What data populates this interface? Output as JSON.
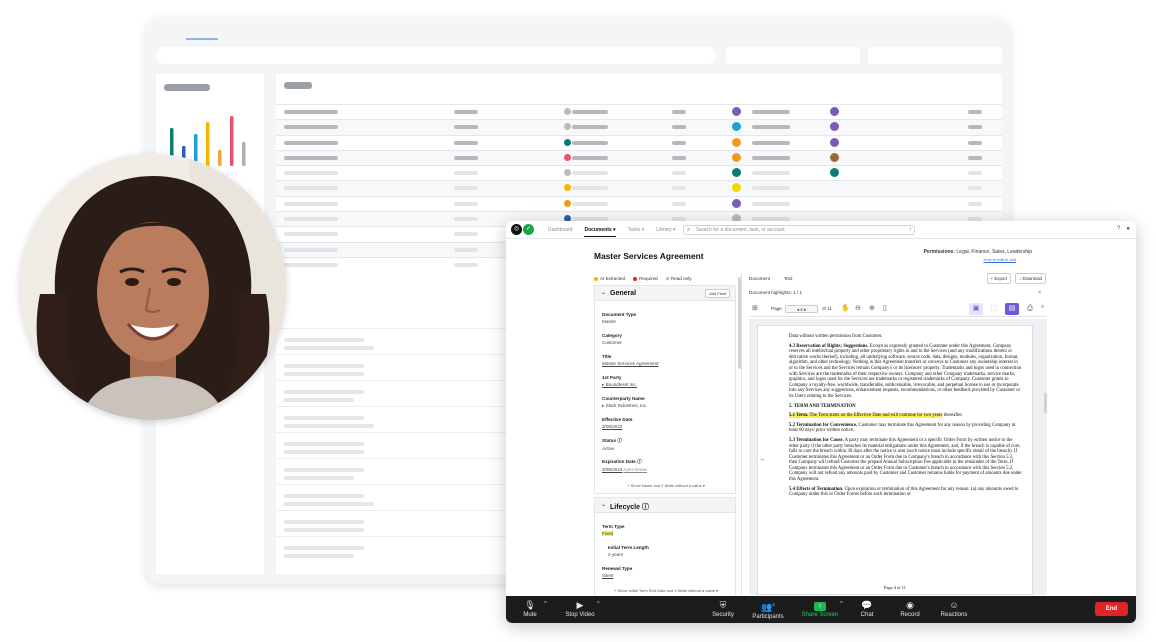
{
  "app": {
    "nav": [
      "Dashboard",
      "Documents ▾",
      "Tasks ▾",
      "Library ▾"
    ],
    "search_placeholder": "Search for a document, task, or account",
    "search_shortcut": "/"
  },
  "document": {
    "title": "Master Services Agreement",
    "permissions_label": "Permissions:",
    "permissions_value": "Legal, Finance, Sales, Leadership",
    "permissions_link": "How to edit/or add",
    "legend": [
      "AI Extracted",
      "Required",
      "Read only"
    ],
    "legend_colors": [
      "#f2b300",
      "#e0242a",
      "#888888"
    ]
  },
  "general": {
    "title": "General",
    "add_field": "Add Field",
    "fields": [
      {
        "label": "Document Type",
        "value": "Master"
      },
      {
        "label": "Category",
        "value": "Customer"
      },
      {
        "label": "Title",
        "value": "Master Services Agreement"
      },
      {
        "label": "1st Party",
        "value": "▸ Boundlesst Inc."
      },
      {
        "label": "Counterparty Name",
        "value": "▸ Stark Industries, Inc."
      },
      {
        "label": "Effective Date",
        "value": "3/08/2022"
      },
      {
        "label": "Status ⓘ",
        "value": "Active"
      },
      {
        "label": "Expiration Date ⓘ",
        "value": "3/09/2024"
      }
    ],
    "expiration_extra": "Auto-renew",
    "show_more": "+ Show Name and 2 fields without a value ▾"
  },
  "lifecycle": {
    "title": "Lifecycle ⓘ",
    "fields": [
      {
        "label": "Term Type",
        "value": "Fixed"
      },
      {
        "label": "Initial Term Length",
        "value": "2 years"
      },
      {
        "label": "Renewal Type",
        "value": "Silent"
      }
    ],
    "show_more": "+ Show Initial Term End Date and 4 fields without a value ▾"
  },
  "viewer": {
    "tabs": [
      "Document",
      "Text"
    ],
    "export": "+ Export",
    "download": "↓ Download",
    "highlights": "Document highlights: 1 / 1",
    "page_label": "Page",
    "page_value": "4",
    "page_of": "of 11",
    "page_number": "Page 4 of 11"
  },
  "contract": {
    "p0": "Data without written permission from Customer.",
    "p1_head": "4.3 Reservation of Rights; Suggestions.",
    "p1_body": " Except as expressly granted to Customer under this Agreement, Company reserves all intellectual property and other proprietary rights in and to the Services (and any modifications thereto or derivative works thereof), including, all underlying software, source code, data, designs, modules, organization, format, algorithm, and other technology. Nothing in this Agreement transfers or conveys to Customer any ownership interest in or to the Services and the Services remain Company's or its licensors' property. Trademarks and logos used in connection with Services are the trademarks of their respective owners. Company and other Company trademarks, service marks, graphics, and logos used for the Services are trademarks or registered trademarks of Company. Customer grants to Company a royalty-free, worldwide, transferable, sublicensable, irrevocable, and perpetual license to use or incorporate into any Services any suggestions, enhancement requests, recommendations, or other feedback provided by Customer or its Users relating to the Services.",
    "s5": "5. TERM AND TERMINATION",
    "p51_head": "5.1 Term.",
    "p51_hl": " The Term starts on the Effective Date and will continue for two years",
    "p51_tail": " thereafter.",
    "p52_head": "5.2 Termination for Convenience.",
    "p52_body": " Customer may terminate this Agreement for any reason by providing Company at least 60 days' prior written notice.",
    "p53_head": "5.3 Termination for Cause.",
    "p53_body": " A party may terminate this Agreement or a specific Order Form by written notice to the other party if the other party breaches its material obligations under this Agreement, and, if the breach is capable of cure, fails to cure the breach within 30 days after the notice is sent (such notice must include specific detail of the breach). If Customer terminates this Agreement or an Order Form due to Company's breach in accordance with this Section 5.3, then Company will refund Customer the prepaid Annual Subscription Fee applicable to the remainder of the Term. If Company terminates this Agreement or an Order Form due to Customer's breach in accordance with this Section 5.2, Company will not refund any amounts paid by Customer and Customer remains liable for payment of amounts due under this Agreement.",
    "p54_head": "5.4 Effects of Termination.",
    "p54_body": " Upon expiration or termination of this Agreement for any reason: (a) any amounts owed to Company under this or Order Forms before such termination or"
  },
  "meeting": {
    "mute": "Mute",
    "video": "Stop Video",
    "security": "Security",
    "participants": "Participants",
    "participants_count": "2",
    "share": "Share Screen",
    "chat": "Chat",
    "record": "Record",
    "reactions": "Reactions",
    "end": "End"
  },
  "colors": {
    "accent_green": "#1fb74f",
    "end_red": "#e0242a",
    "viewer_blue": "#6b5bd6",
    "highlight_yellow": "#f8ee4f"
  }
}
